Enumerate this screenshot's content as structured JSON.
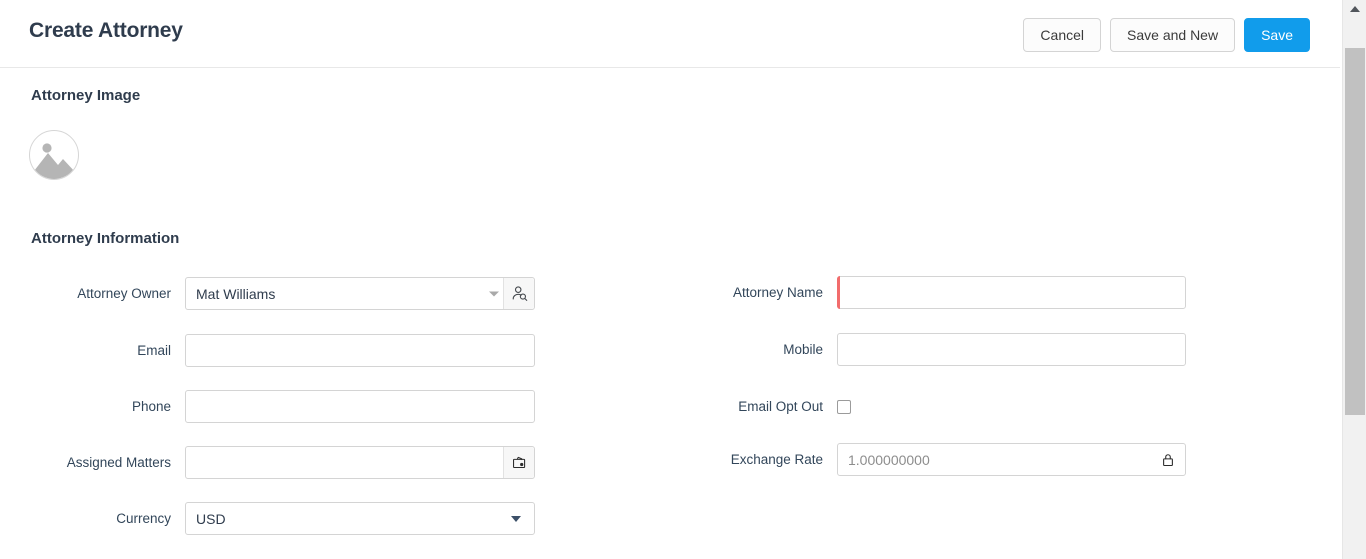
{
  "header": {
    "title": "Create Attorney",
    "buttons": [
      {
        "label": "Cancel",
        "name": "cancel-button",
        "style": "secondary"
      },
      {
        "label": "Save and New",
        "name": "save-and-new-button",
        "style": "secondary"
      },
      {
        "label": "Save",
        "name": "save-button",
        "style": "primary"
      }
    ]
  },
  "sections": {
    "image": {
      "title": "Attorney Image",
      "placeholder_icon": "image-placeholder-icon"
    },
    "information": {
      "title": "Attorney Information"
    }
  },
  "fields": {
    "attorney_owner": {
      "label": "Attorney Owner",
      "value": "Mat Williams",
      "icon": "user-lookup-icon"
    },
    "attorney_name": {
      "label": "Attorney Name",
      "value": "",
      "placeholder": "",
      "required": true
    },
    "email": {
      "label": "Email",
      "value": "",
      "placeholder": ""
    },
    "mobile": {
      "label": "Mobile",
      "value": "",
      "placeholder": ""
    },
    "phone": {
      "label": "Phone",
      "value": "",
      "placeholder": ""
    },
    "email_opt_out": {
      "label": "Email Opt Out",
      "checked": false
    },
    "assigned_matters": {
      "label": "Assigned Matters",
      "value": "",
      "placeholder": "",
      "icon": "briefcase-lookup-icon"
    },
    "exchange_rate": {
      "label": "Exchange Rate",
      "value": "1.000000000",
      "readonly": true,
      "icon": "lock-icon"
    },
    "currency": {
      "label": "Currency",
      "value": "USD",
      "icon": "chevron-down-icon"
    }
  },
  "colors": {
    "primary": "#119ceb",
    "required": "#f26c6c",
    "label": "#32465a",
    "title": "#2f3c4d"
  }
}
